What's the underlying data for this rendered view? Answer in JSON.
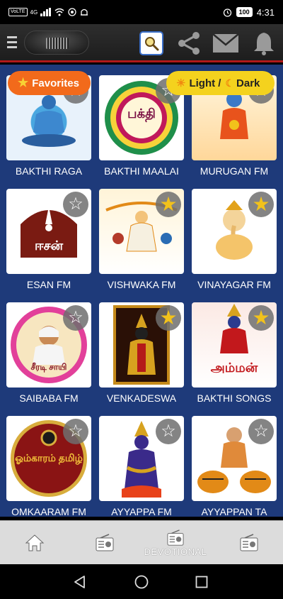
{
  "status_bar": {
    "volte": "VoLTE",
    "network": "4G",
    "battery": "100",
    "time": "4:31"
  },
  "header": {
    "menu_icon": "hamburger-icon",
    "logo": "radio-logo",
    "actions": [
      "search-icon",
      "share-icon",
      "mail-icon",
      "bell-icon"
    ]
  },
  "pills": {
    "favorites": "Favorites",
    "light_dark_1": "Light /",
    "light_dark_2": "Dark"
  },
  "stations": [
    {
      "name": "BAKTHI RAGA",
      "fav": false
    },
    {
      "name": "BAKTHI MAALAI",
      "fav": false,
      "art": "பக்தி"
    },
    {
      "name": "MURUGAN FM",
      "fav": false
    },
    {
      "name": "ESAN FM",
      "fav": false,
      "art": "ஈசன்"
    },
    {
      "name": "VISHWAKA FM",
      "fav": true
    },
    {
      "name": "VINAYAGAR FM",
      "fav": true
    },
    {
      "name": "SAIBABA FM",
      "fav": false,
      "art": "சீரடி சாயி"
    },
    {
      "name": "VENKADESWA",
      "fav": true
    },
    {
      "name": "BAKTHI SONGS",
      "fav": true,
      "art": "அம்மன்"
    },
    {
      "name": "OMKAARAM FM",
      "fav": false,
      "art": "ஓம்காரம் தமிழ்"
    },
    {
      "name": "AYYAPPA FM",
      "fav": false
    },
    {
      "name": "AYYAPPAN TA",
      "fav": false
    }
  ],
  "bottom_nav": {
    "devotional_label": "DEVOTIONAL"
  },
  "colors": {
    "grid_bg": "#1e3a7a",
    "accent_red": "#b01919",
    "fav_pill": "#f26a1b",
    "theme_pill": "#f4d21e",
    "star_gold": "#f2c21b"
  }
}
